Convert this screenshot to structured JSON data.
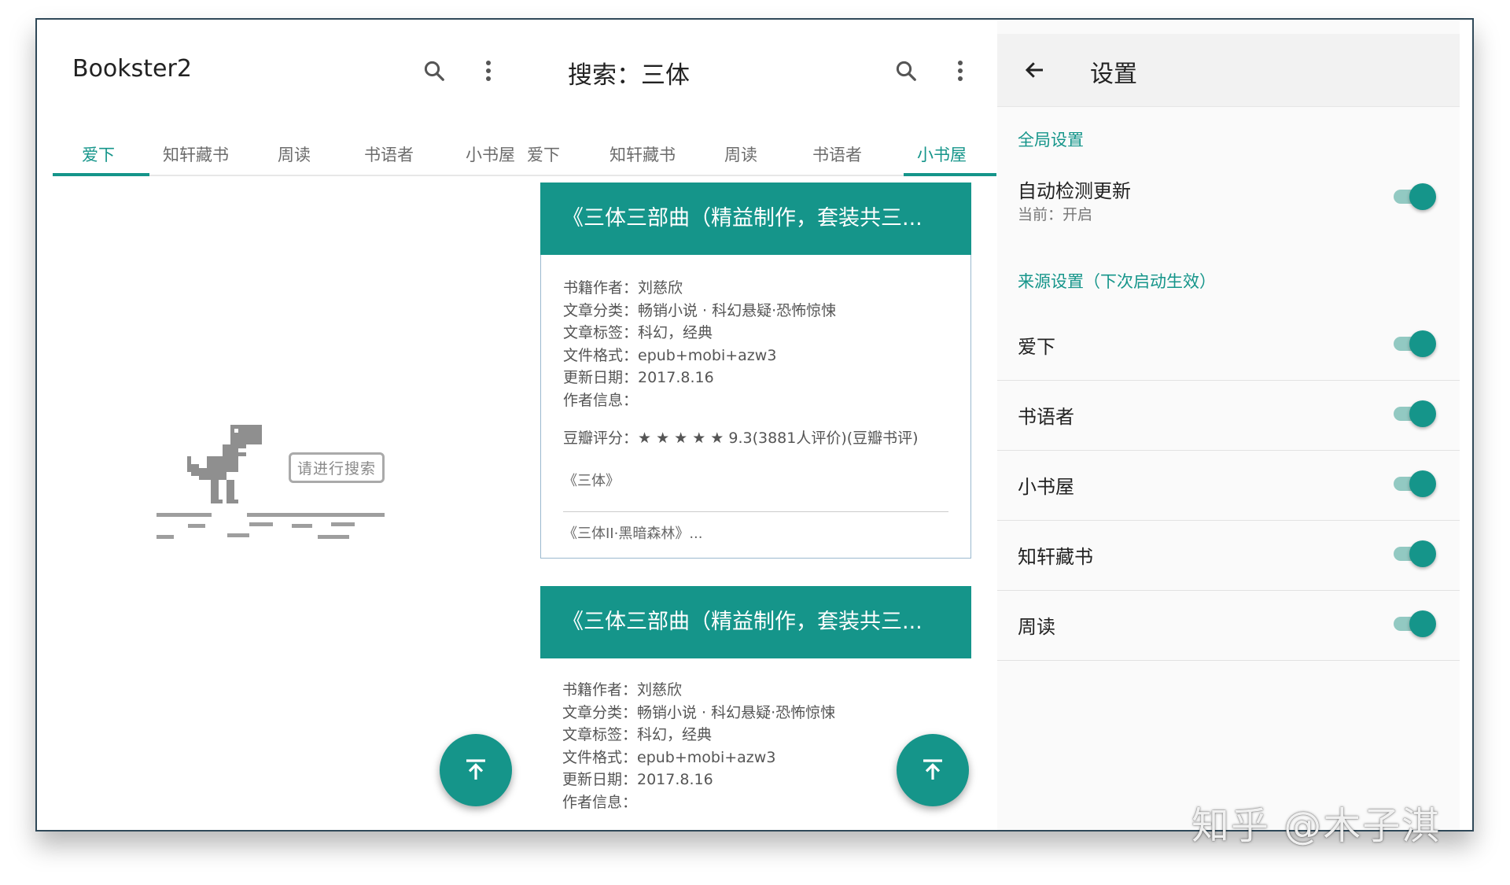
{
  "left_pane": {
    "app_title": "Bookster2",
    "tabs": [
      "爱下",
      "知轩藏书",
      "周读",
      "书语者",
      "小书屋"
    ],
    "active_tab": 0,
    "empty_hint": "请进行搜索",
    "icons": [
      "search-icon",
      "more-vert-icon",
      "dino-icon",
      "arrow-upward-icon"
    ]
  },
  "middle_pane": {
    "title": "搜索：三体",
    "tabs": [
      "爱下",
      "知轩藏书",
      "周读",
      "书语者",
      "小书屋"
    ],
    "active_tab": 4,
    "results": [
      {
        "title": "《三体三部曲（精益制作，套装共三...",
        "meta": [
          "书籍作者：刘慈欣",
          "文章分类：畅销小说 · 科幻悬疑·恐怖惊悚",
          "文章标签：科幻，经典",
          "文件格式：epub+mobi+azw3",
          "更新日期：2017.8.16",
          "作者信息："
        ],
        "rating": "豆瓣评分：★ ★ ★ ★ ★  9.3(3881人评价)(豆瓣书评)",
        "line1": "《三体》",
        "line2": "《三体II·黑暗森林》..."
      },
      {
        "title": "《三体三部曲（精益制作，套装共三...",
        "meta": [
          "书籍作者：刘慈欣",
          "文章分类：畅销小说 · 科幻悬疑·恐怖惊悚",
          "文章标签：科幻，经典",
          "文件格式：epub+mobi+azw3",
          "更新日期：2017.8.16",
          "作者信息："
        ]
      }
    ]
  },
  "settings_pane": {
    "title": "设置",
    "global_section": "全局设置",
    "auto_update": {
      "label": "自动检测更新",
      "sub": "当前：开启",
      "on": true
    },
    "source_section": "来源设置（下次启动生效）",
    "sources": [
      {
        "label": "爱下",
        "on": true
      },
      {
        "label": "书语者",
        "on": true
      },
      {
        "label": "小书屋",
        "on": true
      },
      {
        "label": "知轩藏书",
        "on": true
      },
      {
        "label": "周读",
        "on": true
      }
    ]
  },
  "watermark": "知乎 @木子淇",
  "colors": {
    "accent": "#15958a",
    "accent_light": "#92c9c2"
  }
}
